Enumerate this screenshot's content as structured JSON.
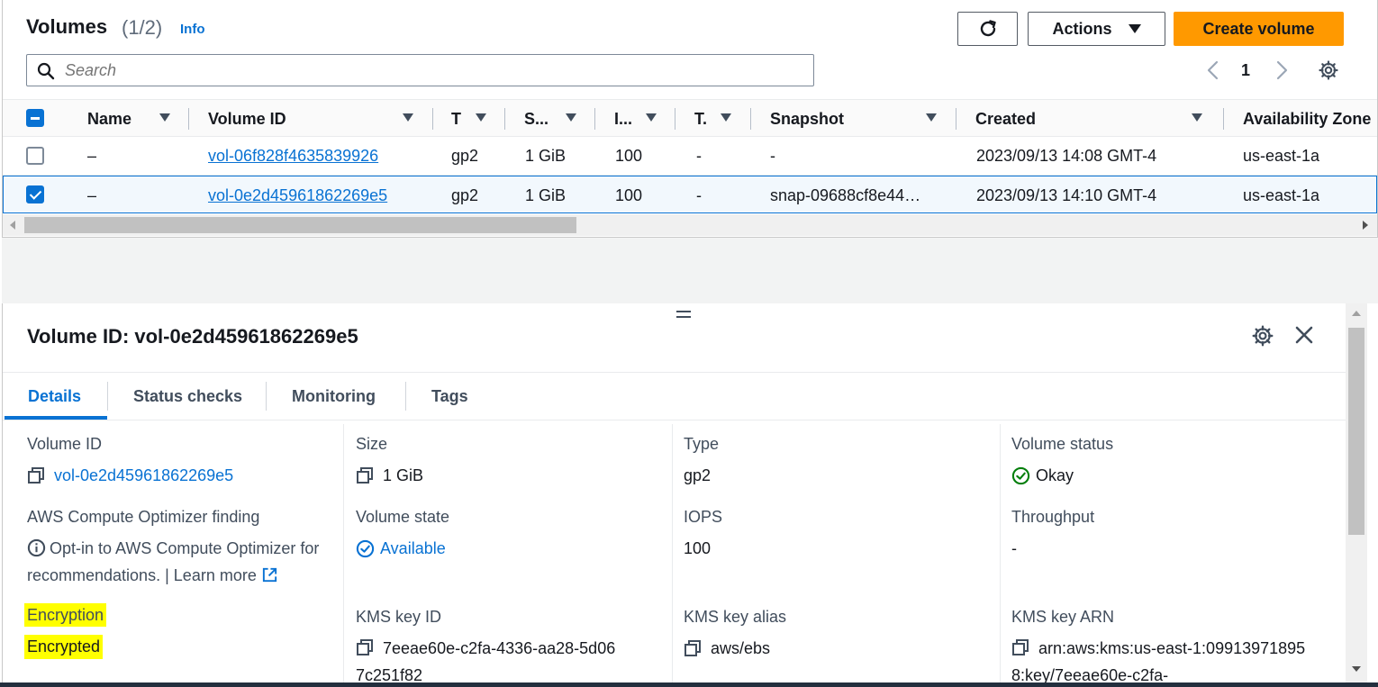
{
  "header": {
    "title": "Volumes",
    "count": "(1/2)",
    "info_label": "Info",
    "actions_label": "Actions",
    "create_label": "Create volume"
  },
  "search": {
    "placeholder": "Search"
  },
  "pagination": {
    "current_page": "1"
  },
  "table": {
    "columns": [
      "Name",
      "Volume ID",
      "T",
      "S...",
      "I...",
      "T.",
      "Snapshot",
      "Created",
      "Availability Zone"
    ],
    "rows": [
      {
        "selected": false,
        "name": "–",
        "volume_id": "vol-06f828f4635839926",
        "type": "gp2",
        "size": "1 GiB",
        "iops": "100",
        "throughput": "-",
        "snapshot": "-",
        "created": "2023/09/13 14:08 GMT-4",
        "az": "us-east-1a"
      },
      {
        "selected": true,
        "name": "–",
        "volume_id": "vol-0e2d45961862269e5",
        "type": "gp2",
        "size": "1 GiB",
        "iops": "100",
        "throughput": "-",
        "snapshot": "snap-09688cf8e44…",
        "created": "2023/09/13 14:10 GMT-4",
        "az": "us-east-1a"
      }
    ]
  },
  "detail": {
    "title": "Volume ID: vol-0e2d45961862269e5",
    "tabs": [
      "Details",
      "Status checks",
      "Monitoring",
      "Tags"
    ],
    "active_tab": "Details",
    "fields": {
      "volume_id": {
        "label": "Volume ID",
        "value": "vol-0e2d45961862269e5"
      },
      "size": {
        "label": "Size",
        "value": "1 GiB"
      },
      "type": {
        "label": "Type",
        "value": "gp2"
      },
      "volume_status": {
        "label": "Volume status",
        "value": "Okay"
      },
      "optimizer": {
        "label": "AWS Compute Optimizer finding",
        "value": "Opt-in to AWS Compute Optimizer for recommendations.",
        "separator": "|",
        "link": "Learn more"
      },
      "volume_state": {
        "label": "Volume state",
        "value": "Available"
      },
      "iops": {
        "label": "IOPS",
        "value": "100"
      },
      "throughput": {
        "label": "Throughput",
        "value": "-"
      },
      "encryption": {
        "label": "Encryption",
        "value": "Encrypted"
      },
      "kms_key_id": {
        "label": "KMS key ID",
        "value": "7eeae60e-c2fa-4336-aa28-5d067c251f82"
      },
      "kms_key_alias": {
        "label": "KMS key alias",
        "value": "aws/ebs"
      },
      "kms_key_arn": {
        "label": "KMS key ARN",
        "value": "arn:aws:kms:us-east-1:099139718958:key/7eeae60e-c2fa-"
      }
    }
  },
  "colors": {
    "primary": "#ff9900",
    "link": "#0972d3",
    "success": "#037f0c",
    "highlight": "#ffff00"
  },
  "icons": [
    "search-icon",
    "refresh-icon",
    "caret-down-icon",
    "chevron-left-icon",
    "chevron-right-icon",
    "gear-icon",
    "close-icon",
    "copy-icon",
    "check-circle-icon",
    "info-icon",
    "external-link-icon",
    "drag-handle-icon"
  ]
}
